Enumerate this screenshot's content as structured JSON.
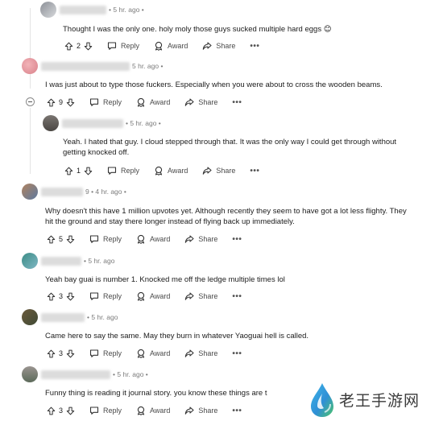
{
  "comments": [
    {
      "meta": "• 5 hr. ago •",
      "text": "Thought I was the only one. holy moly those guys sucked multiple hard eggs 😊",
      "votes": "2",
      "reply": "Reply",
      "award": "Award",
      "share": "Share"
    },
    {
      "meta": "5 hr. ago •",
      "text": "I was just about to type those fuckers. Especially when you were about to cross the wooden beams.",
      "votes": "9",
      "reply": "Reply",
      "award": "Award",
      "share": "Share"
    },
    {
      "meta": "• 5 hr. ago •",
      "text1": "Yeah. I hated that guy. I cloud stepped through that. It was the only way I could get through without",
      "text2": "getting knocked off.",
      "votes": "1",
      "reply": "Reply",
      "award": "Award",
      "share": "Share"
    },
    {
      "meta": "9 • 4 hr. ago •",
      "text1": "Why doesn't this have 1 million upvotes yet. Although recently they seem to have got a lot less flighty. They",
      "text2": "hit the ground and stay there longer instead of flying back up immediately.",
      "votes": "5",
      "reply": "Reply",
      "award": "Award",
      "share": "Share"
    },
    {
      "meta": "• 5 hr. ago",
      "text": "Yeah bay guai is number 1. Knocked me off the ledge multiple times lol",
      "votes": "3",
      "reply": "Reply",
      "award": "Award",
      "share": "Share"
    },
    {
      "meta": "• 5 hr. ago",
      "text": "Came here to say the same. May they burn in whatever Yaoguai hell is called.",
      "votes": "3",
      "reply": "Reply",
      "award": "Award",
      "share": "Share"
    },
    {
      "meta": "• 5 hr. ago •",
      "text": "Funny thing is reading it journal story. you know these things are t",
      "votes": "3",
      "reply": "Reply",
      "award": "Award",
      "share": "Share"
    }
  ],
  "more_label": "•••",
  "watermark": {
    "text": "老王手游网"
  },
  "colors": {
    "text": "#1c1c1c",
    "meta": "#7c7c7c",
    "action": "#4a4a4a"
  }
}
